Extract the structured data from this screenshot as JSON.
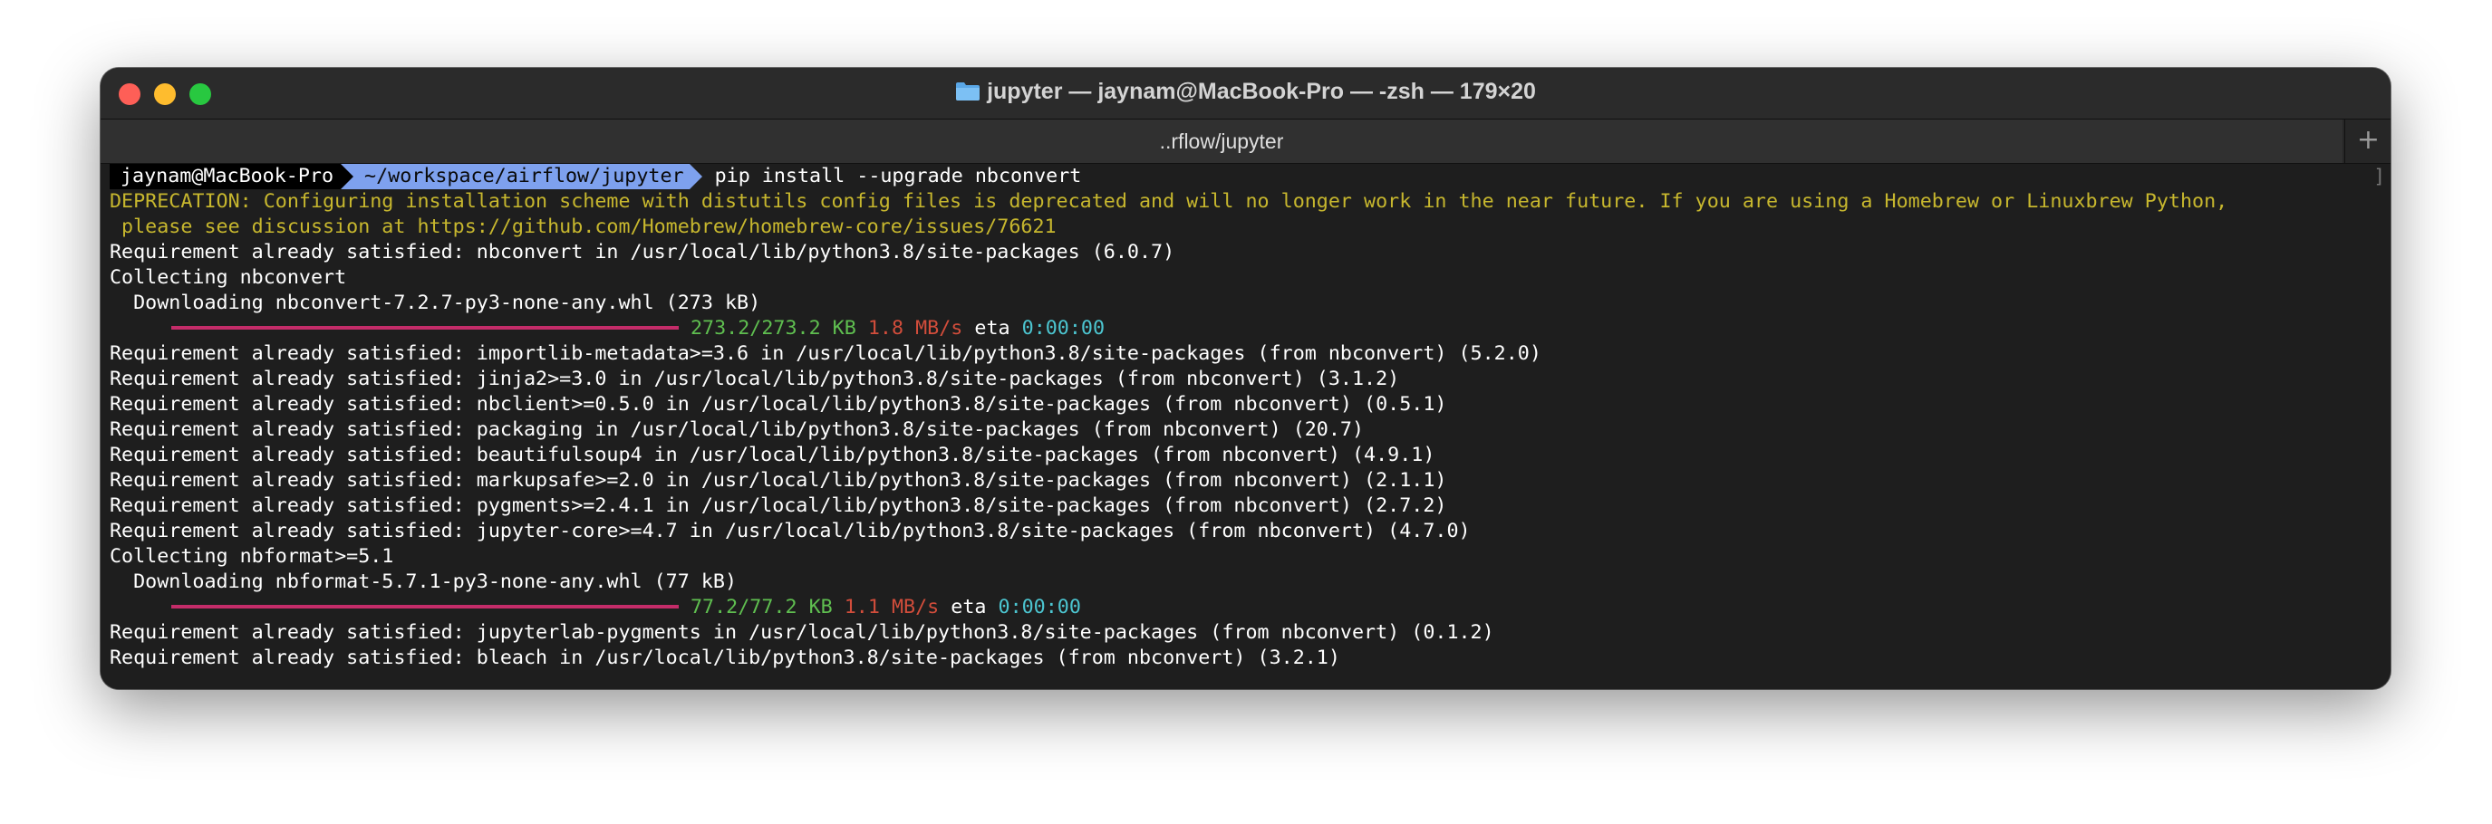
{
  "window": {
    "title": "jupyter — jaynam@MacBook-Pro — -zsh — 179×20",
    "title_icon": "folder-icon"
  },
  "tabs": [
    {
      "label": "..rflow/jupyter"
    }
  ],
  "new_tab_label": "+",
  "prompt": {
    "user": "jaynam@MacBook-Pro",
    "path": "~/workspace/airflow/jupyter",
    "command": "pip install --upgrade nbconvert",
    "right_bracket": "]"
  },
  "output": {
    "deprecation_1": "DEPRECATION: Configuring installation scheme with distutils config files is deprecated and will no longer work in the near future. If you are using a Homebrew or Linuxbrew Python,",
    "deprecation_2": " please see discussion at https://github.com/Homebrew/homebrew-core/issues/76621",
    "line_3": "Requirement already satisfied: nbconvert in /usr/local/lib/python3.8/site-packages (6.0.7)",
    "line_4": "Collecting nbconvert",
    "line_5": "  Downloading nbconvert-7.2.7-py3-none-any.whl (273 kB)",
    "progress_1": {
      "size": "273.2/273.2 KB",
      "speed": "1.8 MB/s",
      "eta_label": "eta",
      "eta": "0:00:00"
    },
    "line_7": "Requirement already satisfied: importlib-metadata>=3.6 in /usr/local/lib/python3.8/site-packages (from nbconvert) (5.2.0)",
    "line_8": "Requirement already satisfied: jinja2>=3.0 in /usr/local/lib/python3.8/site-packages (from nbconvert) (3.1.2)",
    "line_9": "Requirement already satisfied: nbclient>=0.5.0 in /usr/local/lib/python3.8/site-packages (from nbconvert) (0.5.1)",
    "line_10": "Requirement already satisfied: packaging in /usr/local/lib/python3.8/site-packages (from nbconvert) (20.7)",
    "line_11": "Requirement already satisfied: beautifulsoup4 in /usr/local/lib/python3.8/site-packages (from nbconvert) (4.9.1)",
    "line_12": "Requirement already satisfied: markupsafe>=2.0 in /usr/local/lib/python3.8/site-packages (from nbconvert) (2.1.1)",
    "line_13": "Requirement already satisfied: pygments>=2.4.1 in /usr/local/lib/python3.8/site-packages (from nbconvert) (2.7.2)",
    "line_14": "Requirement already satisfied: jupyter-core>=4.7 in /usr/local/lib/python3.8/site-packages (from nbconvert) (4.7.0)",
    "line_15": "Collecting nbformat>=5.1",
    "line_16": "  Downloading nbformat-5.7.1-py3-none-any.whl (77 kB)",
    "progress_2": {
      "size": "77.2/77.2 KB",
      "speed": "1.1 MB/s",
      "eta_label": "eta",
      "eta": "0:00:00"
    },
    "line_18": "Requirement already satisfied: jupyterlab-pygments in /usr/local/lib/python3.8/site-packages (from nbconvert) (0.1.2)",
    "line_19": "Requirement already satisfied: bleach in /usr/local/lib/python3.8/site-packages (from nbconvert) (3.2.1)"
  },
  "colors": {
    "close": "#fe5f57",
    "minimize": "#febc2e",
    "zoom": "#28c840",
    "warning": "#c7b72e",
    "prompt_path_bg": "#7ea1ee",
    "progress_bar": "#c42c69",
    "progress_size": "#5fbf50",
    "progress_speed": "#d24d3b",
    "progress_eta": "#4cc5d0"
  }
}
